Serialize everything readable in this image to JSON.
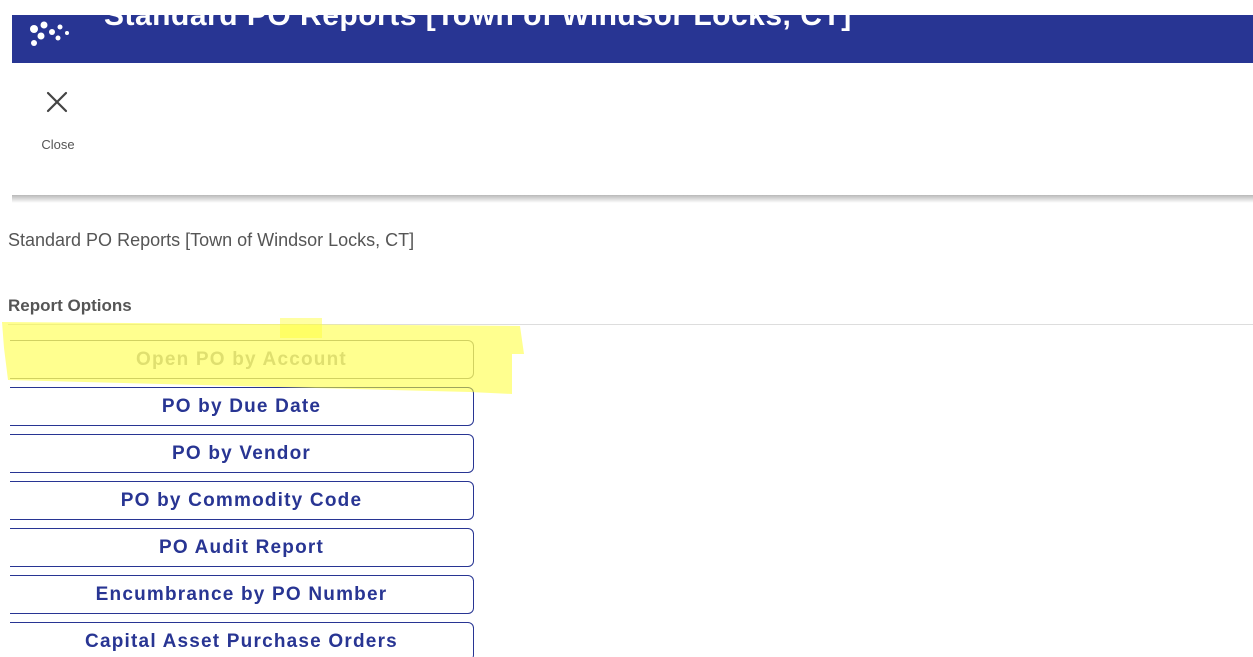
{
  "header": {
    "title": "Standard PO Reports [Town of Windsor Locks, CT]",
    "background": "#283593",
    "logo_icon": "dots-logo-icon"
  },
  "toolbar": {
    "close_label": "Close",
    "close_icon": "close-x-icon"
  },
  "page": {
    "heading": "Standard PO Reports [Town of Windsor Locks, CT]"
  },
  "report_options": {
    "label": "Report Options",
    "buttons": [
      {
        "label": "Open PO by Account",
        "disabled": true
      },
      {
        "label": "PO by Due Date",
        "disabled": false
      },
      {
        "label": "PO by Vendor",
        "disabled": false
      },
      {
        "label": "PO by Commodity Code",
        "disabled": false
      },
      {
        "label": "PO Audit Report",
        "disabled": false
      },
      {
        "label": "Encumbrance by PO Number",
        "disabled": false
      },
      {
        "label": "Capital Asset Purchase Orders",
        "disabled": false
      }
    ]
  },
  "colors": {
    "accent": "#283593",
    "highlight": "#ffff33"
  }
}
